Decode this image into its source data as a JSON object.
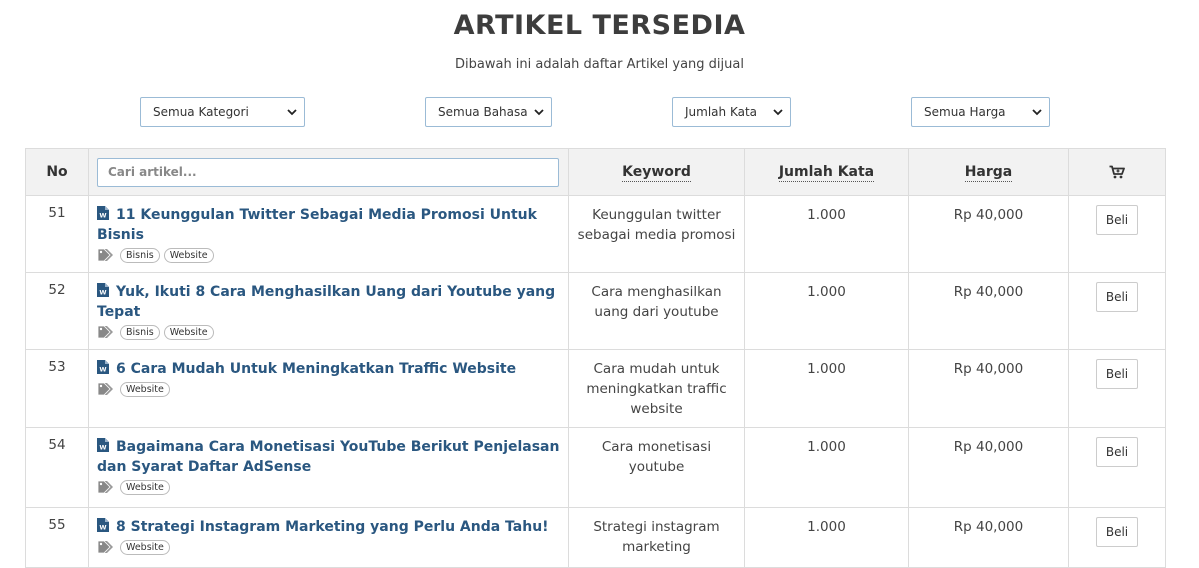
{
  "header": {
    "title": "ARTIKEL TERSEDIA",
    "subtitle": "Dibawah ini adalah daftar Artikel yang dijual"
  },
  "filters": {
    "kategori": "Semua Kategori",
    "bahasa": "Semua Bahasa",
    "jumlah_kata": "Jumlah Kata",
    "harga": "Semua Harga"
  },
  "table": {
    "columns": {
      "no": "No",
      "search_placeholder": "Cari artikel...",
      "keyword": "Keyword",
      "jumlah_kata": "Jumlah Kata",
      "harga": "Harga",
      "cart_icon": "cart-icon"
    },
    "rows": [
      {
        "no": "51",
        "title": "11 Keunggulan Twitter Sebagai Media Promosi Untuk Bisnis",
        "tags": [
          "Bisnis",
          "Website"
        ],
        "keyword": "Keunggulan twitter sebagai media promosi",
        "jumlah_kata": "1.000",
        "harga": "Rp 40,000",
        "beli": "Beli"
      },
      {
        "no": "52",
        "title": "Yuk, Ikuti 8 Cara Menghasilkan Uang dari Youtube yang Tepat",
        "tags": [
          "Bisnis",
          "Website"
        ],
        "keyword": "Cara menghasilkan uang dari youtube",
        "jumlah_kata": "1.000",
        "harga": "Rp 40,000",
        "beli": "Beli"
      },
      {
        "no": "53",
        "title": "6 Cara Mudah Untuk Meningkatkan Traffic Website",
        "tags": [
          "Website"
        ],
        "keyword": "Cara mudah untuk meningkatkan traffic website",
        "jumlah_kata": "1.000",
        "harga": "Rp 40,000",
        "beli": "Beli"
      },
      {
        "no": "54",
        "title": "Bagaimana Cara Monetisasi YouTube Berikut Penjelasan dan Syarat Daftar AdSense",
        "tags": [
          "Website"
        ],
        "keyword": "Cara monetisasi youtube",
        "jumlah_kata": "1.000",
        "harga": "Rp 40,000",
        "beli": "Beli"
      },
      {
        "no": "55",
        "title": "8 Strategi Instagram Marketing yang Perlu Anda Tahu!",
        "tags": [
          "Website"
        ],
        "keyword": "Strategi instagram marketing",
        "jumlah_kata": "1.000",
        "harga": "Rp 40,000",
        "beli": "Beli"
      }
    ]
  },
  "colors": {
    "title_link": "#2a5780",
    "header_bg": "#f2f2f2",
    "input_border": "#9bbbd6"
  }
}
